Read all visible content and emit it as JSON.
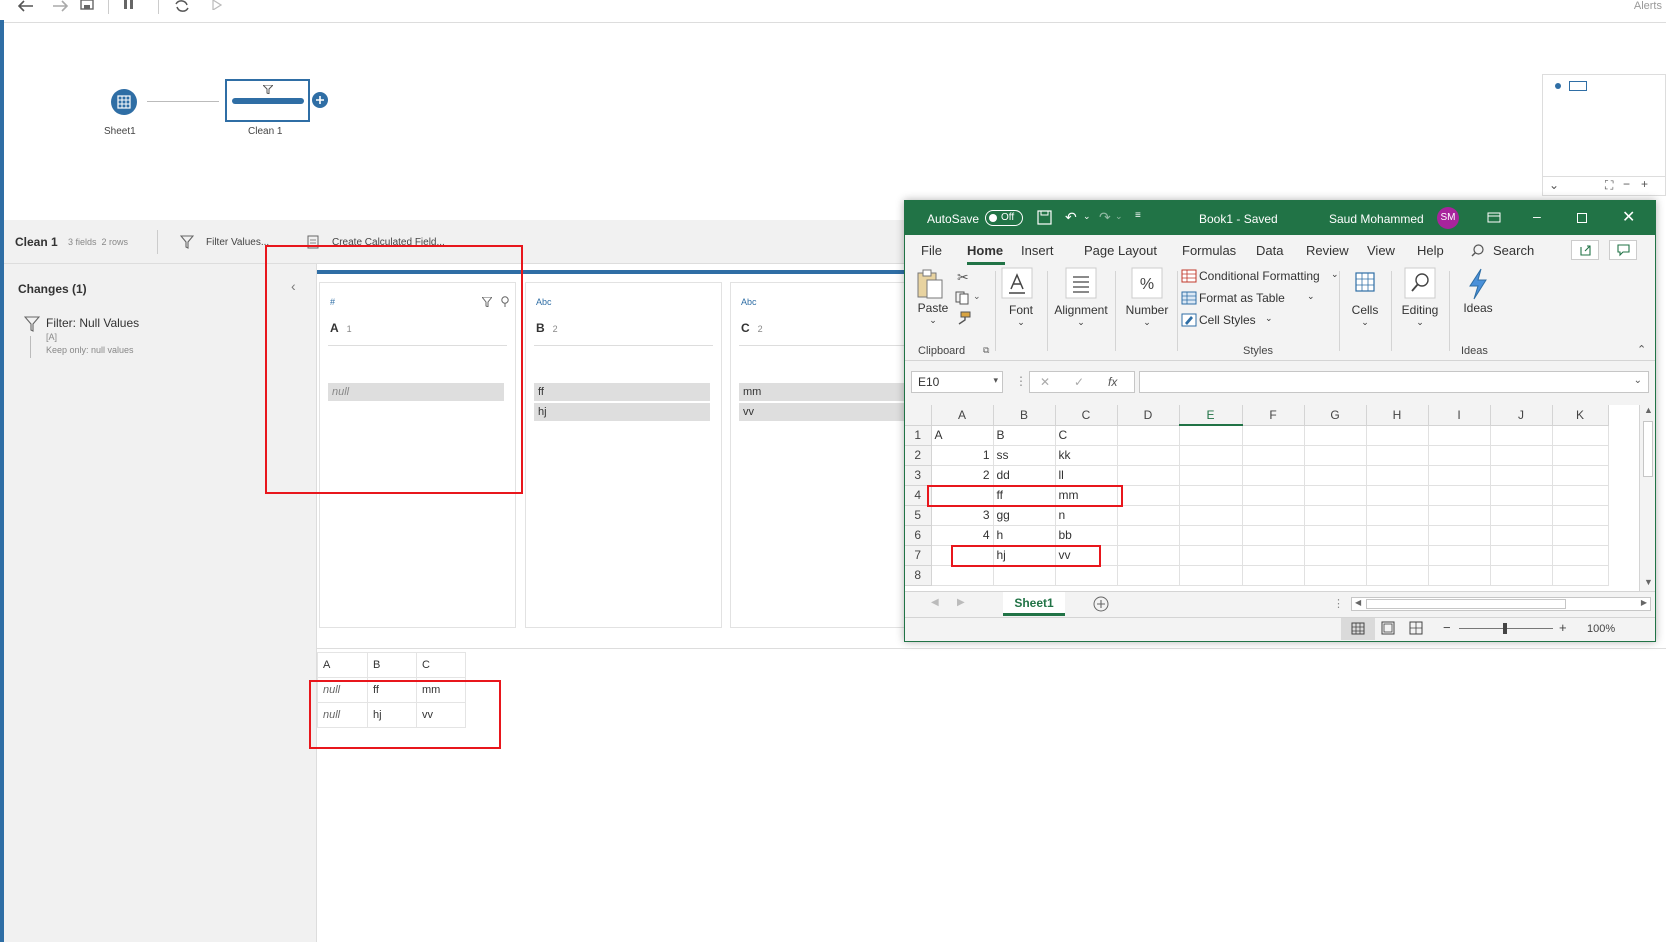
{
  "prep": {
    "alerts_label": "Alerts",
    "flow": {
      "node1_label": "Sheet1",
      "node2_label": "Clean 1"
    },
    "clean_bar": {
      "title": "Clean 1",
      "meta": "3 fields  2 rows",
      "filter_values": "Filter Values...",
      "create_calc": "Create Calculated Field..."
    },
    "changes": {
      "title": "Changes (1)",
      "item_title": "Filter: Null Values",
      "item_field": "[A]",
      "item_desc": "Keep only: null values"
    },
    "profile": [
      {
        "type": "#",
        "name": "A",
        "count": "1",
        "values": [
          "null"
        ]
      },
      {
        "type": "Abc",
        "name": "B",
        "count": "2",
        "values": [
          "ff",
          "hj"
        ]
      },
      {
        "type": "Abc",
        "name": "C",
        "count": "2",
        "values": [
          "mm",
          "vv"
        ]
      }
    ],
    "grid": {
      "headers": [
        "A",
        "B",
        "C"
      ],
      "rows": [
        [
          "null",
          "ff",
          "mm"
        ],
        [
          "null",
          "hj",
          "vv"
        ]
      ]
    }
  },
  "excel": {
    "autosave": "AutoSave",
    "toggle": "Off",
    "title": "Book1 - Saved",
    "user": "Saud Mohammed",
    "initials": "SM",
    "tabs": [
      "File",
      "Home",
      "Insert",
      "Page Layout",
      "Formulas",
      "Data",
      "Review",
      "View",
      "Help"
    ],
    "search": "Search",
    "ribbon": {
      "paste": "Paste",
      "clipboard": "Clipboard",
      "font": "Font",
      "alignment": "Alignment",
      "number": "Number",
      "cond_format": "Conditional Formatting",
      "format_table": "Format as Table",
      "cell_styles": "Cell Styles",
      "styles": "Styles",
      "cells": "Cells",
      "editing": "Editing",
      "ideas": "Ideas",
      "ideas_group": "Ideas"
    },
    "name_box": "E10",
    "fx": "fx",
    "columns": [
      "A",
      "B",
      "C",
      "D",
      "E",
      "F",
      "G",
      "H",
      "I",
      "J",
      "K"
    ],
    "rows": [
      [
        "A",
        "B",
        "C"
      ],
      [
        "1",
        "ss",
        "kk"
      ],
      [
        "2",
        "dd",
        "ll"
      ],
      [
        "",
        "ff",
        "mm"
      ],
      [
        "3",
        "gg",
        "n"
      ],
      [
        "4",
        "h",
        "bb"
      ],
      [
        "",
        "hj",
        "vv"
      ],
      [
        "",
        "",
        ""
      ]
    ],
    "sheet_tab": "Sheet1",
    "zoom": "100%"
  }
}
